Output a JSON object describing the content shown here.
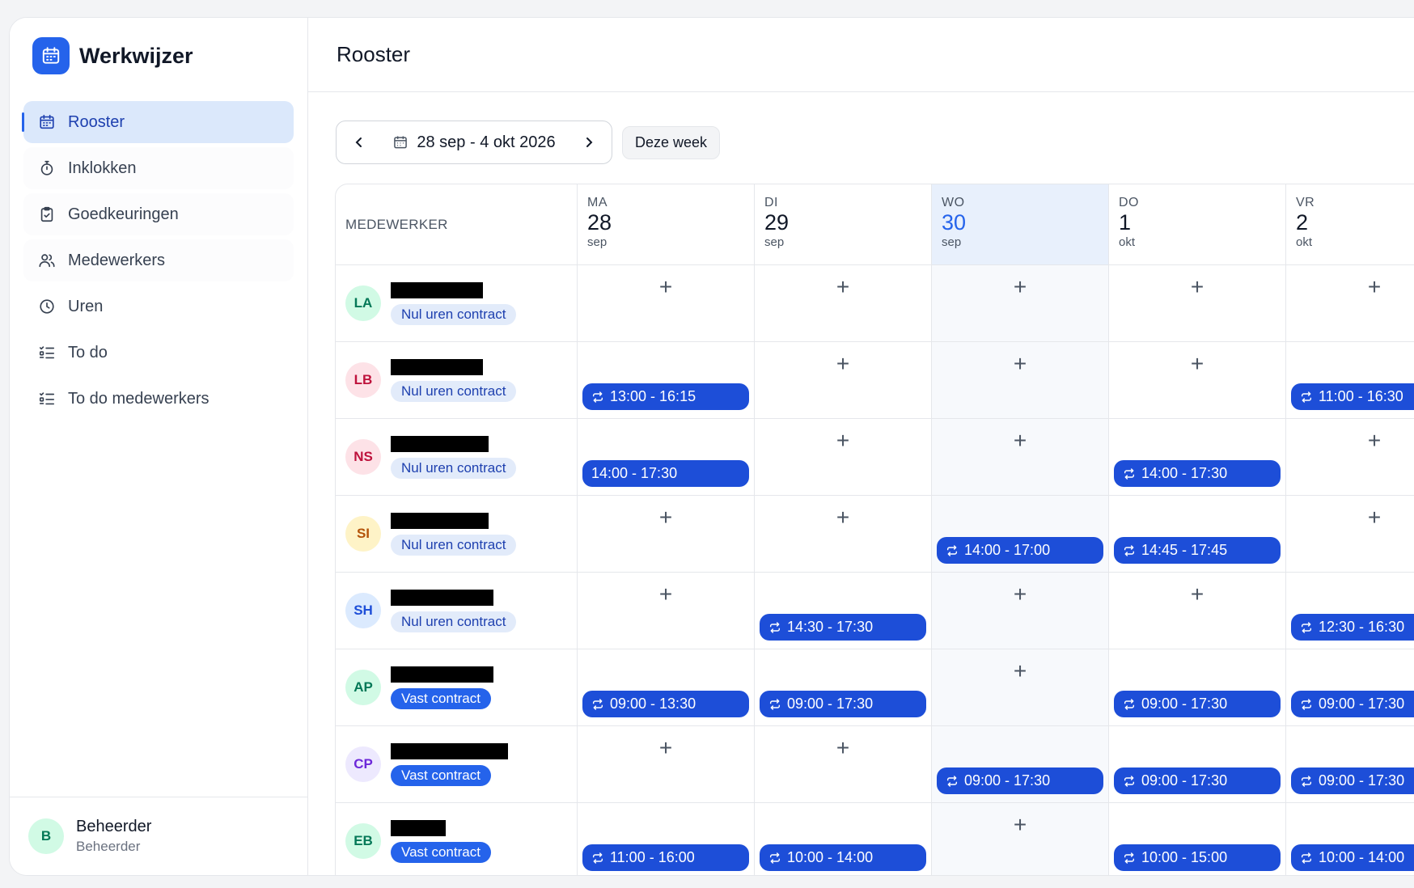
{
  "app": {
    "name": "Werkwijzer"
  },
  "sidebar": {
    "items": [
      {
        "label": "Rooster",
        "icon": "calendar-icon",
        "active": true
      },
      {
        "label": "Inklokken",
        "icon": "stopwatch-icon"
      },
      {
        "label": "Goedkeuringen",
        "icon": "clipboard-check-icon"
      },
      {
        "label": "Medewerkers",
        "icon": "users-icon"
      },
      {
        "label": "Uren",
        "icon": "clock-icon"
      },
      {
        "label": "To do",
        "icon": "checklist-icon"
      },
      {
        "label": "To do medewerkers",
        "icon": "checklist-icon"
      }
    ],
    "user": {
      "initial": "B",
      "name": "Beheerder",
      "role": "Beheerder"
    }
  },
  "header": {
    "title": "Rooster"
  },
  "toolbar": {
    "week_range": "28 sep - 4 okt 2026",
    "today_label": "Deze week"
  },
  "grid": {
    "employee_header": "MEDEWERKER",
    "days": [
      {
        "dow": "MA",
        "num": "28",
        "month": "sep"
      },
      {
        "dow": "DI",
        "num": "29",
        "month": "sep"
      },
      {
        "dow": "WO",
        "num": "30",
        "month": "sep",
        "today": true
      },
      {
        "dow": "DO",
        "num": "1",
        "month": "okt"
      },
      {
        "dow": "VR",
        "num": "2",
        "month": "okt"
      }
    ],
    "rows": [
      {
        "initials": "LA",
        "contract": "Nul uren contract",
        "contract_type": "zero",
        "shifts": [
          null,
          null,
          null,
          null,
          null
        ]
      },
      {
        "initials": "LB",
        "contract": "Nul uren contract",
        "contract_type": "zero",
        "shifts": [
          {
            "time": "13:00 - 16:15",
            "repeat": true
          },
          null,
          null,
          null,
          {
            "time": "11:00 - 16:30",
            "repeat": true
          }
        ]
      },
      {
        "initials": "NS",
        "contract": "Nul uren contract",
        "contract_type": "zero",
        "shifts": [
          {
            "time": "14:00 - 17:30",
            "repeat": false
          },
          null,
          null,
          {
            "time": "14:00 - 17:30",
            "repeat": true
          },
          null
        ]
      },
      {
        "initials": "SI",
        "contract": "Nul uren contract",
        "contract_type": "zero",
        "shifts": [
          null,
          null,
          {
            "time": "14:00 - 17:00",
            "repeat": true
          },
          {
            "time": "14:45 - 17:45",
            "repeat": true
          },
          null
        ]
      },
      {
        "initials": "SH",
        "contract": "Nul uren contract",
        "contract_type": "zero",
        "shifts": [
          null,
          {
            "time": "14:30 - 17:30",
            "repeat": true
          },
          null,
          null,
          {
            "time": "12:30 - 16:30",
            "repeat": true
          }
        ]
      },
      {
        "initials": "AP",
        "contract": "Vast contract",
        "contract_type": "vast",
        "shifts": [
          {
            "time": "09:00 - 13:30",
            "repeat": true
          },
          {
            "time": "09:00 - 17:30",
            "repeat": true
          },
          null,
          {
            "time": "09:00 - 17:30",
            "repeat": true
          },
          {
            "time": "09:00 - 17:30",
            "repeat": true
          }
        ]
      },
      {
        "initials": "CP",
        "contract": "Vast contract",
        "contract_type": "vast",
        "shifts": [
          null,
          null,
          {
            "time": "09:00 - 17:30",
            "repeat": true
          },
          {
            "time": "09:00 - 17:30",
            "repeat": true
          },
          {
            "time": "09:00 - 17:30",
            "repeat": true
          }
        ]
      },
      {
        "initials": "EB",
        "contract": "Vast contract",
        "contract_type": "vast",
        "shifts": [
          {
            "time": "11:00 - 16:00",
            "repeat": true
          },
          {
            "time": "10:00 - 14:00",
            "repeat": true
          },
          null,
          {
            "time": "10:00 - 15:00",
            "repeat": true
          },
          {
            "time": "10:00 - 14:00",
            "repeat": true
          }
        ]
      }
    ]
  },
  "colors": {
    "accent": "#2563eb",
    "shift": "#1d4ed8",
    "today_bg": "#e8f0fc"
  }
}
